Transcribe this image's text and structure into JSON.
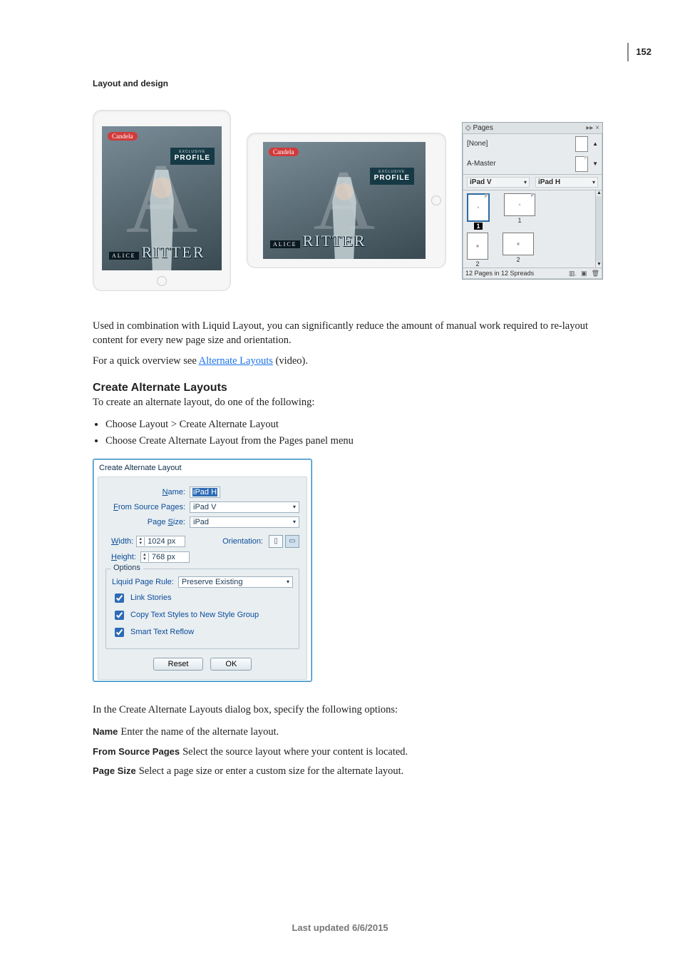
{
  "page_number": "152",
  "running_title": "Layout and design",
  "magazine": {
    "brand": "Candela",
    "profile_mini": "EXCLUSIVE",
    "profile_label": "PROFILE",
    "alice": "ALICE",
    "ritter": "RITTER"
  },
  "pages_panel": {
    "tab": "◇ Pages",
    "none": "[None]",
    "a_master": "A-Master",
    "col_v": "iPad V",
    "col_h": "iPad H",
    "thumbs": [
      "1",
      "1",
      "2",
      "2"
    ],
    "status": "12 Pages in 12 Spreads"
  },
  "para1": "Used in combination with Liquid Layout, you can significantly reduce the amount of manual work required to re-layout content for every new page size and orientation.",
  "para2_a": "For a quick overview see ",
  "para2_link": "Alternate Layouts",
  "para2_b": " (video).",
  "h2": "Create Alternate Layouts",
  "lead": "To create an alternate layout, do one of the following:",
  "bullets": [
    "Choose Layout > Create Alternate Layout",
    "Choose Create Alternate Layout from the Pages panel menu"
  ],
  "dialog": {
    "title": "Create Alternate Layout",
    "name_label": "Name:",
    "name_value": "iPad H",
    "from_label_u": "F",
    "from_label_r": "rom Source Pages:",
    "from_value": "iPad V",
    "size_label_a": "Page ",
    "size_label_u": "S",
    "size_label_b": "ize:",
    "size_value": "iPad",
    "width_label_u": "W",
    "width_label_r": "idth:",
    "width_value": "1024 px",
    "height_label_u": "H",
    "height_label_r": "eight:",
    "height_value": "768 px",
    "orientation_label": "Orientation:",
    "options_legend": "Options",
    "rule_label_a": "Liquid Page ",
    "rule_label_u": "R",
    "rule_label_b": "ule:",
    "rule_value": "Preserve Existing",
    "chk1_u": "L",
    "chk1_r": "ink Stories",
    "chk2_u": "C",
    "chk2_r": "opy Text Styles to New Style Group",
    "chk3_u": "S",
    "chk3_r": "mart Text Reflow",
    "reset": "Reset",
    "ok": "OK"
  },
  "afterdialog": "In the Create Alternate Layouts dialog box, specify the following options:",
  "defs": [
    {
      "term": "Name",
      "body": "Enter the name of the alternate layout."
    },
    {
      "term": "From Source Pages",
      "body": "Select the source layout where your content is located."
    },
    {
      "term": "Page Size",
      "body": "Select a page size or enter a custom size for the alternate layout."
    }
  ],
  "footer": "Last updated 6/6/2015"
}
